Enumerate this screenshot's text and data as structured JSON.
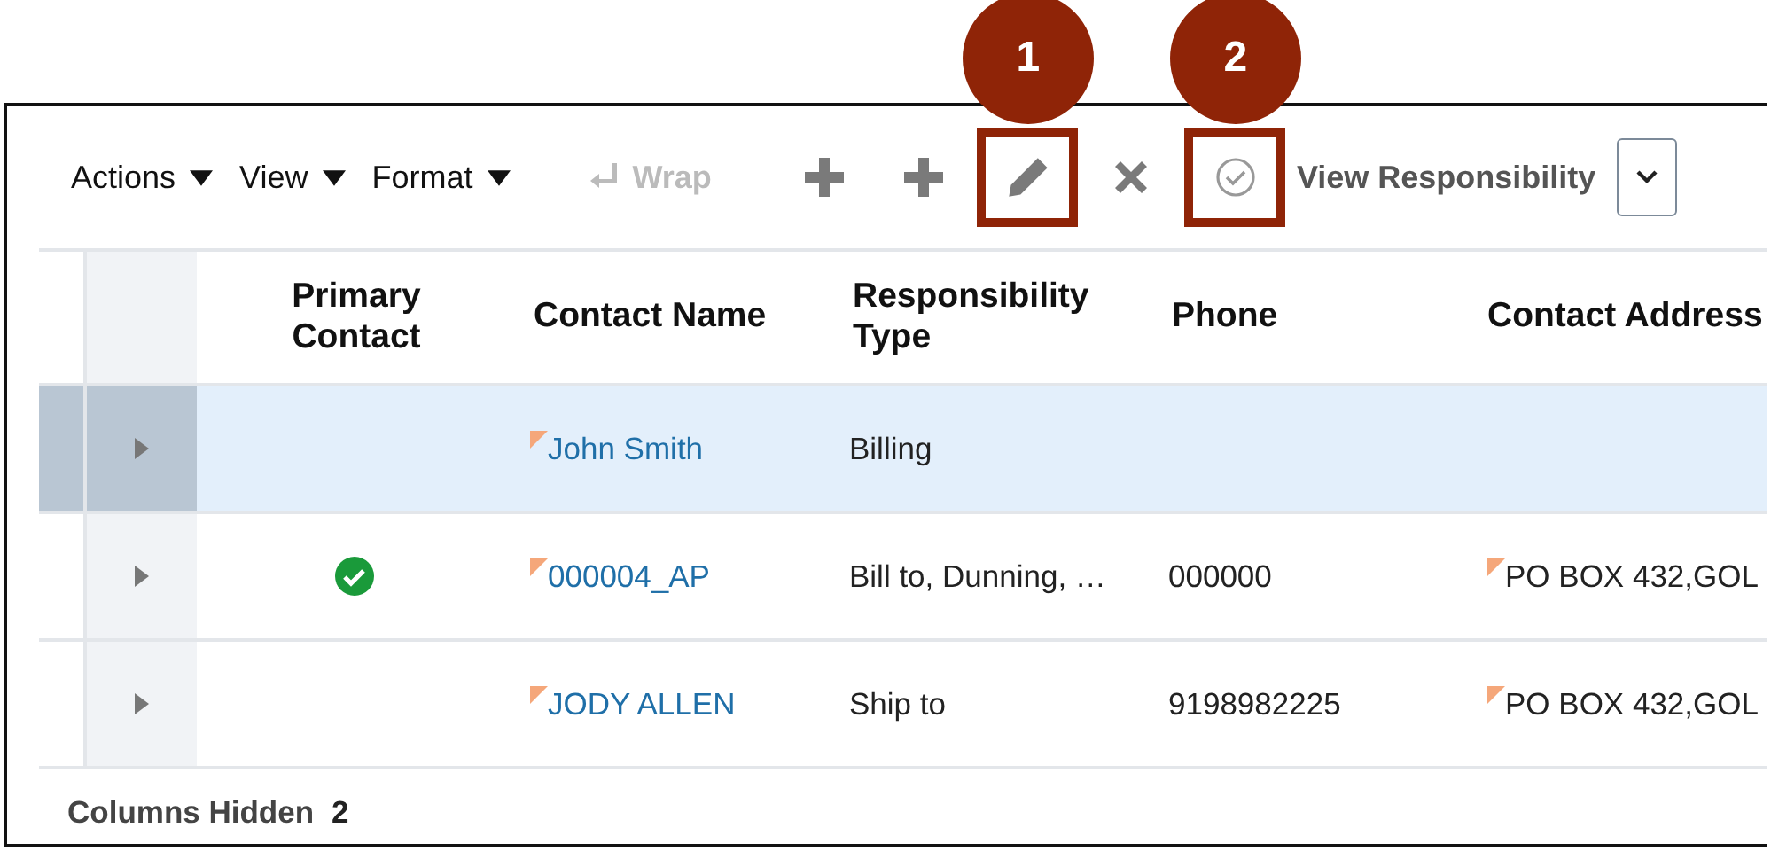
{
  "toolbar": {
    "menus": [
      {
        "label": "Actions"
      },
      {
        "label": "View"
      },
      {
        "label": "Format"
      }
    ],
    "wrap": {
      "label": "Wrap",
      "disabled": true
    },
    "tools": [
      {
        "kind": "add",
        "highlighted": false
      },
      {
        "kind": "add",
        "highlighted": false
      },
      {
        "kind": "edit",
        "highlighted": true,
        "callout": "1"
      },
      {
        "kind": "delete",
        "highlighted": false
      },
      {
        "kind": "approve",
        "highlighted": true,
        "callout": "2"
      }
    ],
    "view_button": {
      "label": "View Responsibility"
    }
  },
  "table": {
    "columns": [
      "Primary Contact",
      "Contact Name",
      "Responsibility Type",
      "Phone",
      "Contact Address"
    ],
    "rows": [
      {
        "selected": true,
        "primary": false,
        "name": "John Smith",
        "type": "Billing",
        "phone": "",
        "address": ""
      },
      {
        "selected": false,
        "primary": true,
        "name": "000004_AP",
        "type": "Bill to, Dunning, …",
        "phone": "000000",
        "address": "PO BOX 432,GOL"
      },
      {
        "selected": false,
        "primary": false,
        "name": "JODY ALLEN",
        "type": "Ship to",
        "phone": "9198982225",
        "address": "PO BOX 432,GOL"
      }
    ]
  },
  "status_bar": {
    "label": "Columns Hidden",
    "count": "2"
  }
}
